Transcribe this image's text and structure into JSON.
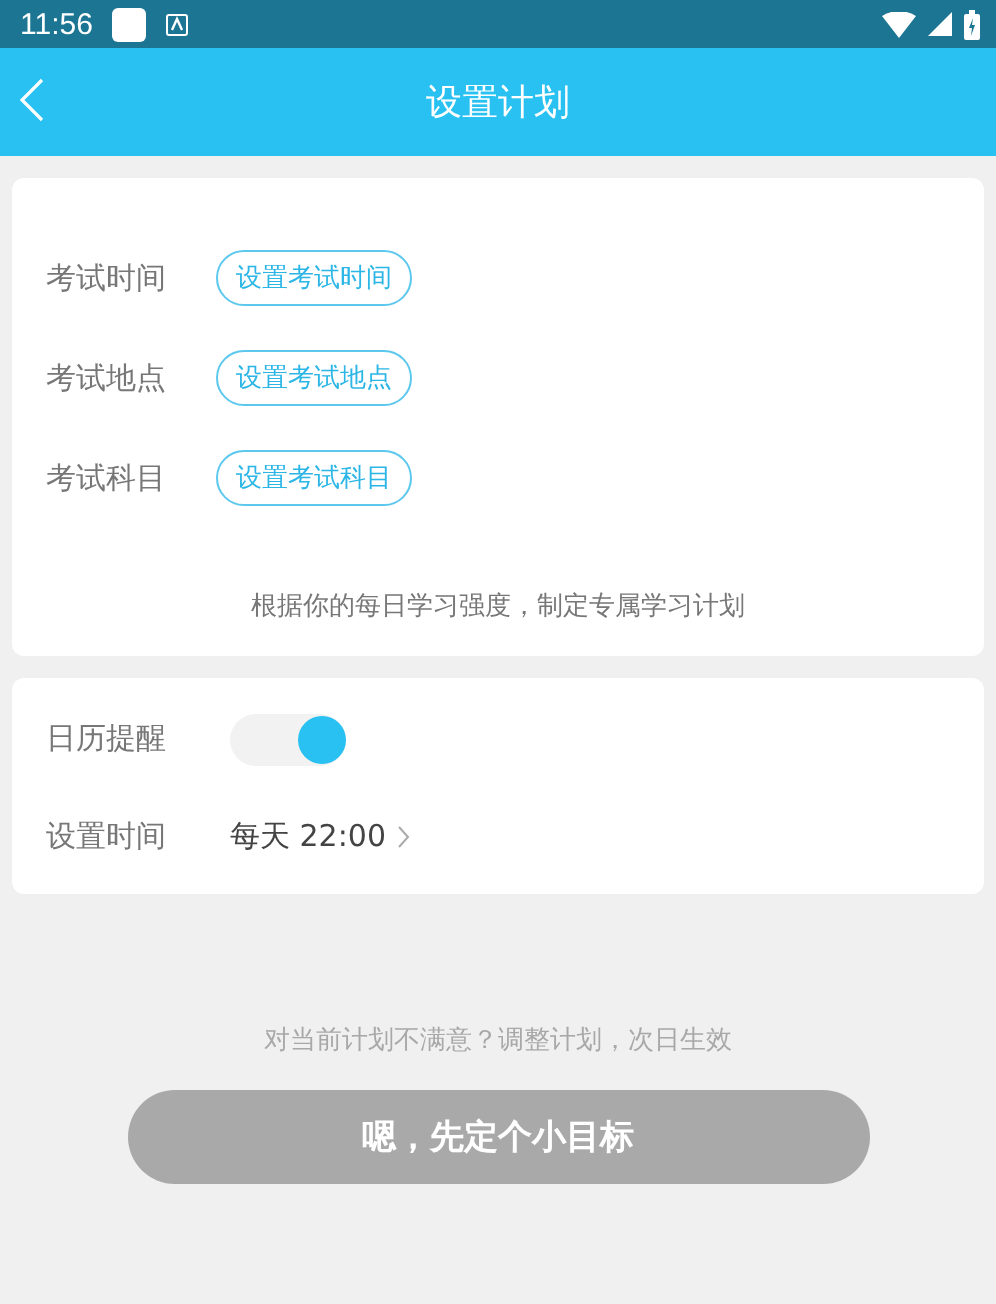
{
  "status_bar": {
    "time": "11:56"
  },
  "header": {
    "title": "设置计划"
  },
  "exam_settings": [
    {
      "label": "考试时间",
      "action": "设置考试时间"
    },
    {
      "label": "考试地点",
      "action": "设置考试地点"
    },
    {
      "label": "考试科目",
      "action": "设置考试科目"
    }
  ],
  "exam_note": "根据你的每日学习强度，制定专属学习计划",
  "reminder": {
    "label": "日历提醒",
    "on": true
  },
  "reminder_time": {
    "label": "设置时间",
    "value": "每天 22:00"
  },
  "adjust_hint": "对当前计划不满意？调整计划，次日生效",
  "confirm_button": {
    "label": "嗯，先定个小目标",
    "disabled": true
  }
}
